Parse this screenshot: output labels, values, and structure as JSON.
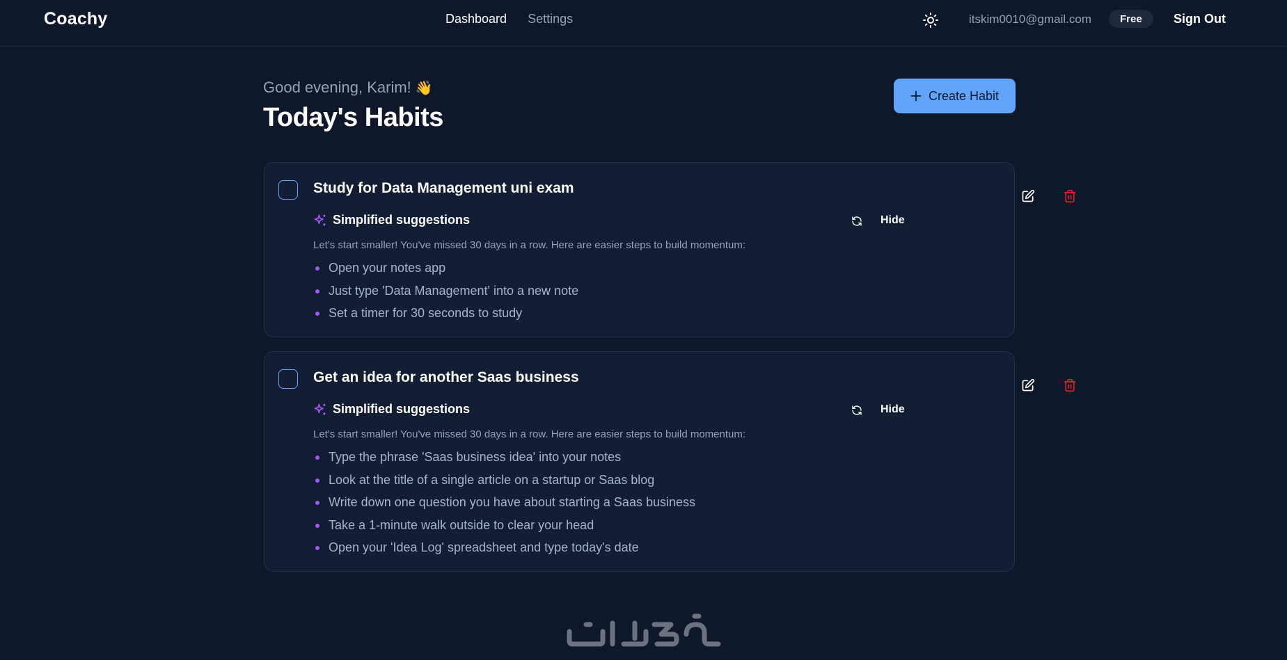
{
  "header": {
    "logo": "Coachy",
    "nav": [
      {
        "label": "Dashboard"
      },
      {
        "label": "Settings"
      }
    ],
    "email": "itskim0010@gmail.com",
    "plan_badge": "Free",
    "sign_out": "Sign Out",
    "theme_icon": "sun-icon"
  },
  "main": {
    "greeting": "Good evening, Karim!",
    "greeting_emoji": "👋",
    "title": "Today's Habits",
    "create_button": "Create Habit"
  },
  "habits": [
    {
      "title": "Study for Data Management uni exam",
      "suggestions_title": "Simplified suggestions",
      "hide_label": "Hide",
      "intro": "Let's start smaller! You've missed 30 days in a row. Here are easier steps to build momentum:",
      "steps": [
        "Open your notes app",
        "Just type 'Data Management' into a new note",
        "Set a timer for 30 seconds to study"
      ]
    },
    {
      "title": "Get an idea for another Saas business",
      "suggestions_title": "Simplified suggestions",
      "hide_label": "Hide",
      "intro": "Let's start smaller! You've missed 30 days in a row. Here are easier steps to build momentum:",
      "steps": [
        "Type the phrase 'Saas business idea' into your notes",
        "Look at the title of a single article on a startup or Saas blog",
        "Write down one question you have about starting a Saas business",
        "Take a 1-minute walk outside to clear your head",
        "Open your 'Idea Log' spreadsheet and type today's date"
      ]
    }
  ],
  "colors": {
    "background": "#0f172a",
    "card": "#131d33",
    "accent": "#60a5fa",
    "danger": "#dc2626",
    "sparkle": "#a855f7"
  }
}
